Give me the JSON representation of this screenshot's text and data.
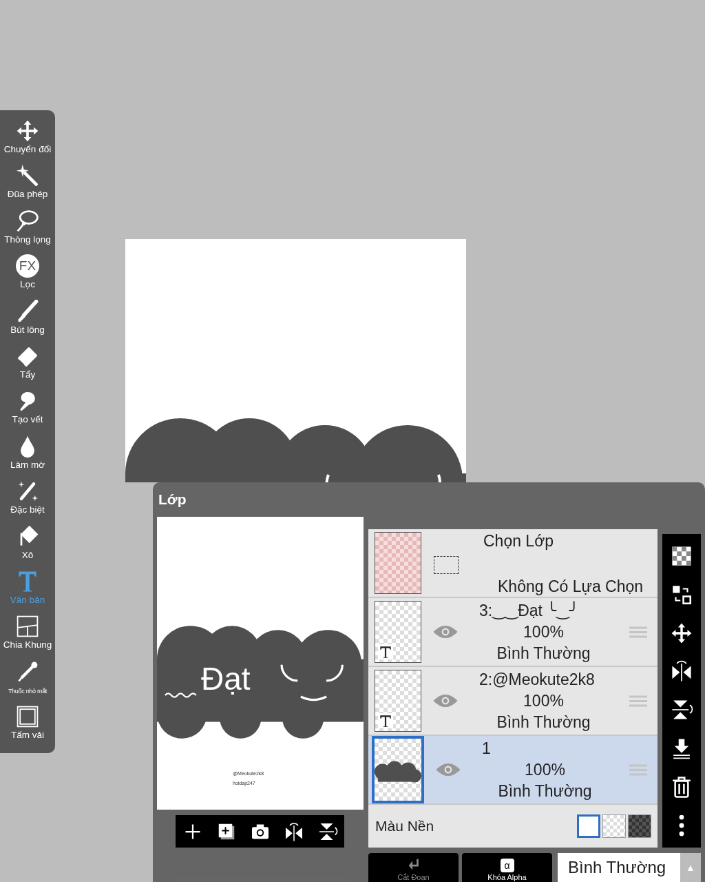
{
  "toolbar": {
    "tools": [
      {
        "label": "Chuyển đổi",
        "selected": false
      },
      {
        "label": "Đũa phép",
        "selected": false
      },
      {
        "label": "Thòng lọng",
        "selected": false
      },
      {
        "label": "Lọc",
        "selected": false,
        "glyph": "FX"
      },
      {
        "label": "Bút lông",
        "selected": false
      },
      {
        "label": "Tẩy",
        "selected": false
      },
      {
        "label": "Tạo vết",
        "selected": false
      },
      {
        "label": "Làm mờ",
        "selected": false
      },
      {
        "label": "Đặc biệt",
        "selected": false
      },
      {
        "label": "Xô",
        "selected": false
      },
      {
        "label": "Văn bản",
        "selected": true
      },
      {
        "label": "Chia Khung",
        "selected": false
      },
      {
        "label": "Thuốc nhỏ mắt",
        "selected": false
      },
      {
        "label": "Tấm vải",
        "selected": false
      }
    ]
  },
  "layers_panel": {
    "title": "Lớp",
    "preview": {
      "title": "Đạt",
      "credit_1": "@Meokute2k8",
      "credit_2": "hoidap247"
    },
    "selection": {
      "title": "Chọn Lớp",
      "status": "Không Có Lựa Chọn"
    },
    "layers": [
      {
        "kind": "text",
        "name": "3:‿‿Đạt ╰‿╯",
        "opacity": "100%",
        "blend": "Bình Thường",
        "visible": true,
        "selected": false
      },
      {
        "kind": "text",
        "name": "2:@Meokute2k8",
        "opacity": "100%",
        "blend": "Bình Thường",
        "visible": true,
        "selected": false
      },
      {
        "kind": "raster",
        "name": "1",
        "opacity": "100%",
        "blend": "Bình Thường",
        "visible": true,
        "selected": true
      }
    ],
    "background": {
      "label": "Màu Nền",
      "swatches": [
        {
          "kind": "white",
          "selected": true
        },
        {
          "kind": "transparent",
          "selected": false
        },
        {
          "kind": "dark",
          "selected": false
        }
      ]
    },
    "clipping": {
      "label": "Cắt Đoạn",
      "disabled": true
    },
    "alpha_lock": {
      "label": "Khóa Alpha",
      "glyph": "α",
      "disabled": false
    },
    "blend_mode": {
      "value": "Bình Thường",
      "arrow": "▲"
    }
  }
}
